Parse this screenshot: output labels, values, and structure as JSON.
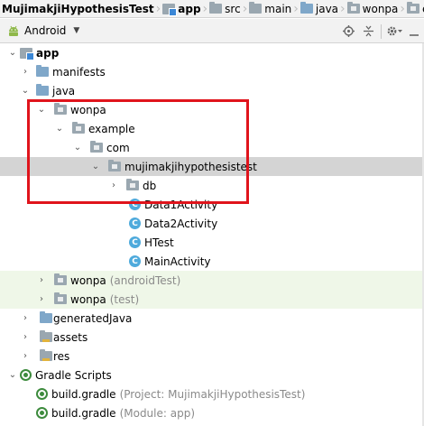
{
  "breadcrumb": [
    {
      "label": "MujimakjiHypothesisTest",
      "bold": true,
      "icon": "module-icon"
    },
    {
      "label": "app",
      "bold": true,
      "icon": "folder-icon"
    },
    {
      "label": "src",
      "bold": false,
      "icon": "folder-icon"
    },
    {
      "label": "main",
      "bold": false,
      "icon": "folder-icon"
    },
    {
      "label": "java",
      "bold": false,
      "icon": "folder-icon"
    },
    {
      "label": "wonpa",
      "bold": false,
      "icon": "package-icon"
    },
    {
      "label": "e",
      "bold": false,
      "icon": "package-icon"
    }
  ],
  "toolbar": {
    "view_label": "Android",
    "buttons": [
      "target-icon",
      "collapse-all-icon",
      "gear-icon",
      "hide-icon"
    ]
  },
  "tree": {
    "app": "app",
    "manifests": "manifests",
    "java": "java",
    "wonpa": "wonpa",
    "example": "example",
    "com": "com",
    "mujimakjihypothesistest": "mujimakjihypothesistest",
    "db": "db",
    "classes": [
      "Data1Activity",
      "Data2Activity",
      "HTest",
      "MainActivity"
    ],
    "class_badge": "C",
    "wonpa_android_test": {
      "label": "wonpa",
      "suffix": "(androidTest)"
    },
    "wonpa_test": {
      "label": "wonpa",
      "suffix": "(test)"
    },
    "generated_java": "generatedJava",
    "assets": "assets",
    "res": "res",
    "gradle_scripts": "Gradle Scripts",
    "build_gradle_project": {
      "label": "build.gradle",
      "suffix": "(Project: MujimakjiHypothesisTest)"
    },
    "build_gradle_module": {
      "label": "build.gradle",
      "suffix": "(Module: app)"
    }
  },
  "colors": {
    "highlight_box": "#e0141c",
    "selected_row": "#d4d4d4",
    "test_rows": "#eff7e8",
    "class_icon": "#4eaadc",
    "gradle_icon": "#3d8b3d"
  }
}
